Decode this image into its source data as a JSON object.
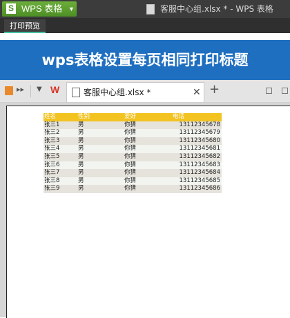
{
  "titlebar": {
    "app_name": "WPS 表格",
    "app_logo": "S",
    "window_title": "客服中心组.xlsx * - WPS 表格"
  },
  "tabbar": {
    "print_preview_label": "打印预览"
  },
  "banner": {
    "text": "wps表格设置每页相同打印标题"
  },
  "docstrip": {
    "logo": "W",
    "file_tab_label": "客服中心组.xlsx *",
    "close_glyph": "✕",
    "new_tab_glyph": "+"
  },
  "sheet": {
    "headers": [
      "姓名",
      "性别",
      "爱好",
      "电话"
    ],
    "rows": [
      [
        "张三1",
        "男",
        "你猜",
        "13112345678"
      ],
      [
        "张三2",
        "男",
        "你猜",
        "13112345679"
      ],
      [
        "张三3",
        "男",
        "你猜",
        "13112345680"
      ],
      [
        "张三4",
        "男",
        "你猜",
        "13112345681"
      ],
      [
        "张三5",
        "男",
        "你猜",
        "13112345682"
      ],
      [
        "张三6",
        "男",
        "你猜",
        "13112345683"
      ],
      [
        "张三7",
        "男",
        "你猜",
        "13112345684"
      ],
      [
        "张三8",
        "男",
        "你猜",
        "13112345685"
      ],
      [
        "张三9",
        "男",
        "你猜",
        "13112345686"
      ]
    ]
  },
  "colors": {
    "banner_bg": "#1f6fc0",
    "header_row": "#f2c321",
    "app_button": "#4e8f26",
    "tab_accent": "#45c1a3"
  }
}
